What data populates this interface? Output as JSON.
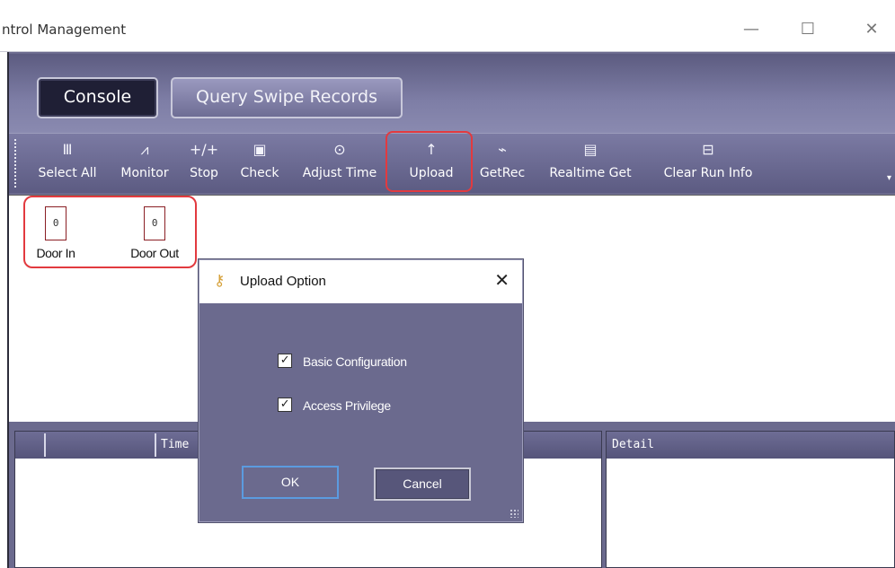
{
  "window": {
    "title": "ntrol Management",
    "minimize_glyph": "—",
    "maximize_glyph": "☐",
    "close_glyph": "✕"
  },
  "nav": {
    "console_label": "Console",
    "query_label": "Query Swipe Records"
  },
  "toolbar": {
    "items": [
      {
        "label": "Select All",
        "icon": "select-all-icon",
        "glyph": "Ⅲ"
      },
      {
        "label": "Monitor",
        "icon": "monitor-icon",
        "glyph": "⩘"
      },
      {
        "label": "Stop",
        "icon": "stop-icon",
        "glyph": "+/+"
      },
      {
        "label": "Check",
        "icon": "check-icon",
        "glyph": "▣"
      },
      {
        "label": "Adjust Time",
        "icon": "clock-icon",
        "glyph": "⊙"
      },
      {
        "label": "Upload",
        "icon": "upload-arrow-icon",
        "glyph": "↑"
      },
      {
        "label": "GetRec",
        "icon": "get-records-icon",
        "glyph": "⌁"
      },
      {
        "label": "Realtime Get",
        "icon": "realtime-get-icon",
        "glyph": "▤"
      },
      {
        "label": "Clear Run Info",
        "icon": "clear-icon",
        "glyph": "⊟"
      }
    ],
    "overflow_glyph": "▾"
  },
  "doors": [
    {
      "label": "Door In",
      "value": "0"
    },
    {
      "label": "Door Out",
      "value": "0"
    }
  ],
  "grid": {
    "time_header": "Time",
    "detail_header": "Detail"
  },
  "dialog": {
    "title": "Upload Option",
    "icon": "key-icon",
    "close_glyph": "✕",
    "options": [
      {
        "label": "Basic Configuration",
        "checked": true
      },
      {
        "label": "Access Privilege",
        "checked": true
      }
    ],
    "check_glyph": "✓",
    "ok_label": "OK",
    "cancel_label": "Cancel"
  },
  "colors": {
    "app_background": "#6b6a8e",
    "highlight_red": "#e23a3f",
    "door_border": "#8a1f24",
    "ok_focus_border": "#5b9be0"
  }
}
